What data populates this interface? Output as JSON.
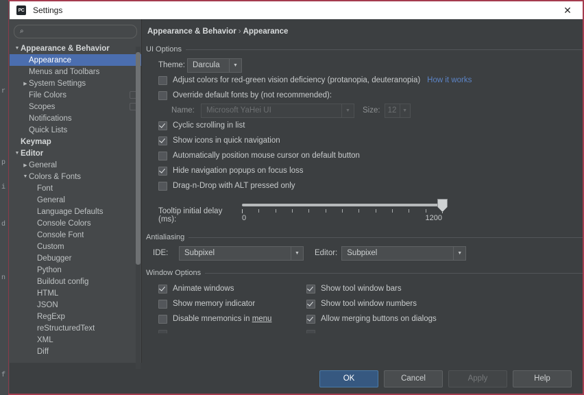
{
  "window": {
    "title": "Settings",
    "icon": "pycharm-icon",
    "icon_text": "PC",
    "close_icon": "close-icon",
    "close_glyph": "✕"
  },
  "background": {
    "fragments": [
      "r",
      "p",
      "i",
      "d",
      "n",
      "f"
    ]
  },
  "sidebar": {
    "search": {
      "placeholder": "",
      "value": "",
      "icon": "search-icon",
      "glyph": "⌕"
    },
    "tree": [
      {
        "label": "Appearance & Behavior",
        "indent": 0,
        "arrow": "down",
        "bold": true,
        "selected": false,
        "badge": false
      },
      {
        "label": "Appearance",
        "indent": 1,
        "arrow": "none",
        "bold": false,
        "selected": true,
        "badge": false
      },
      {
        "label": "Menus and Toolbars",
        "indent": 1,
        "arrow": "none",
        "bold": false,
        "selected": false,
        "badge": false
      },
      {
        "label": "System Settings",
        "indent": 1,
        "arrow": "right",
        "bold": false,
        "selected": false,
        "badge": false
      },
      {
        "label": "File Colors",
        "indent": 1,
        "arrow": "none",
        "bold": false,
        "selected": false,
        "badge": true
      },
      {
        "label": "Scopes",
        "indent": 1,
        "arrow": "none",
        "bold": false,
        "selected": false,
        "badge": true
      },
      {
        "label": "Notifications",
        "indent": 1,
        "arrow": "none",
        "bold": false,
        "selected": false,
        "badge": false
      },
      {
        "label": "Quick Lists",
        "indent": 1,
        "arrow": "none",
        "bold": false,
        "selected": false,
        "badge": false
      },
      {
        "label": "Keymap",
        "indent": 0,
        "arrow": "none",
        "bold": true,
        "selected": false,
        "badge": false
      },
      {
        "label": "Editor",
        "indent": 0,
        "arrow": "down",
        "bold": true,
        "selected": false,
        "badge": false
      },
      {
        "label": "General",
        "indent": 1,
        "arrow": "right",
        "bold": false,
        "selected": false,
        "badge": false
      },
      {
        "label": "Colors & Fonts",
        "indent": 1,
        "arrow": "down",
        "bold": false,
        "selected": false,
        "badge": false
      },
      {
        "label": "Font",
        "indent": 2,
        "arrow": "none",
        "bold": false,
        "selected": false,
        "badge": false
      },
      {
        "label": "General",
        "indent": 2,
        "arrow": "none",
        "bold": false,
        "selected": false,
        "badge": false
      },
      {
        "label": "Language Defaults",
        "indent": 2,
        "arrow": "none",
        "bold": false,
        "selected": false,
        "badge": false
      },
      {
        "label": "Console Colors",
        "indent": 2,
        "arrow": "none",
        "bold": false,
        "selected": false,
        "badge": false
      },
      {
        "label": "Console Font",
        "indent": 2,
        "arrow": "none",
        "bold": false,
        "selected": false,
        "badge": false
      },
      {
        "label": "Custom",
        "indent": 2,
        "arrow": "none",
        "bold": false,
        "selected": false,
        "badge": false
      },
      {
        "label": "Debugger",
        "indent": 2,
        "arrow": "none",
        "bold": false,
        "selected": false,
        "badge": false
      },
      {
        "label": "Python",
        "indent": 2,
        "arrow": "none",
        "bold": false,
        "selected": false,
        "badge": false
      },
      {
        "label": "Buildout config",
        "indent": 2,
        "arrow": "none",
        "bold": false,
        "selected": false,
        "badge": false
      },
      {
        "label": "HTML",
        "indent": 2,
        "arrow": "none",
        "bold": false,
        "selected": false,
        "badge": false
      },
      {
        "label": "JSON",
        "indent": 2,
        "arrow": "none",
        "bold": false,
        "selected": false,
        "badge": false
      },
      {
        "label": "RegExp",
        "indent": 2,
        "arrow": "none",
        "bold": false,
        "selected": false,
        "badge": false
      },
      {
        "label": "reStructuredText",
        "indent": 2,
        "arrow": "none",
        "bold": false,
        "selected": false,
        "badge": false
      },
      {
        "label": "XML",
        "indent": 2,
        "arrow": "none",
        "bold": false,
        "selected": false,
        "badge": false
      },
      {
        "label": "Diff",
        "indent": 2,
        "arrow": "none",
        "bold": false,
        "selected": false,
        "badge": false
      }
    ]
  },
  "breadcrumb": {
    "root": "Appearance & Behavior",
    "separator": "›",
    "leaf": "Appearance"
  },
  "ui_options": {
    "group_title": "UI Options",
    "theme_label": "Theme:",
    "theme_value": "Darcula",
    "adjust_colors": {
      "label": "Adjust colors for red-green vision deficiency (protanopia, deuteranopia)",
      "checked": false
    },
    "how_it_works": "How it works",
    "override_fonts": {
      "label": "Override default fonts by (not recommended):",
      "checked": false
    },
    "name_label": "Name:",
    "name_placeholder": "Microsoft YaHei UI",
    "size_label": "Size:",
    "size_value": "12",
    "cyclic_scrolling": {
      "label": "Cyclic scrolling in list",
      "checked": true
    },
    "show_icons_quick_nav": {
      "label": "Show icons in quick navigation",
      "checked": true
    },
    "auto_position_cursor": {
      "label": "Automatically position mouse cursor on default button",
      "checked": false
    },
    "hide_nav_popups": {
      "label": "Hide navigation popups on focus loss",
      "checked": true
    },
    "drag_n_drop_alt": {
      "label": "Drag-n-Drop with ALT pressed only",
      "checked": false
    },
    "tooltip_delay_label": "Tooltip initial delay (ms):",
    "tooltip_min": "0",
    "tooltip_max": "1200",
    "tooltip_value": 1200
  },
  "antialiasing": {
    "group_title": "Antialiasing",
    "ide_label": "IDE:",
    "ide_value": "Subpixel",
    "editor_label": "Editor:",
    "editor_value": "Subpixel"
  },
  "window_options": {
    "group_title": "Window Options",
    "left": [
      {
        "label": "Animate windows",
        "checked": true
      },
      {
        "label": "Show memory indicator",
        "checked": false
      },
      {
        "label": "Disable mnemonics in menu",
        "checked": false,
        "mnemonic": "menu"
      }
    ],
    "right": [
      {
        "label": "Show tool window bars",
        "checked": true
      },
      {
        "label": "Show tool window numbers",
        "checked": true
      },
      {
        "label": "Allow merging buttons on dialogs",
        "checked": true
      }
    ]
  },
  "buttons": {
    "ok": "OK",
    "cancel": "Cancel",
    "apply": "Apply",
    "help": "Help"
  },
  "colors": {
    "accent_selection": "#4b6eaf",
    "link": "#5c84c6",
    "panel_bg": "#3c3f41",
    "sidebar_bg": "#45484a",
    "primary_button": "#365880",
    "border_red": "#a53b4e"
  }
}
